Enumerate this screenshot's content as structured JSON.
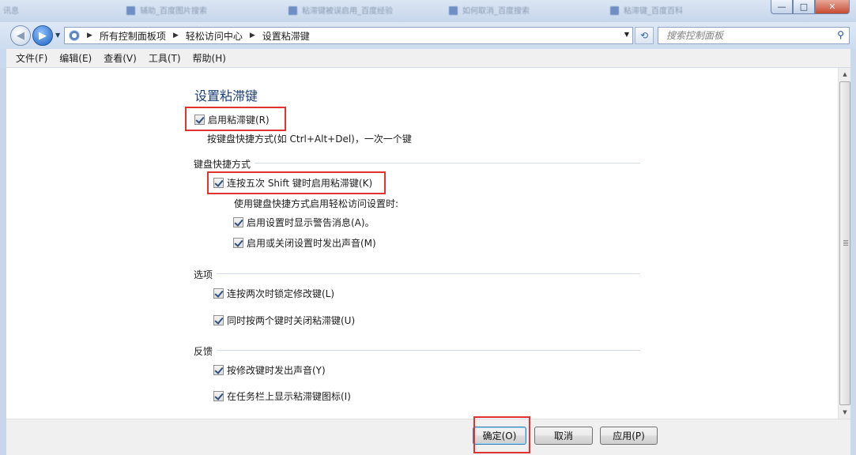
{
  "titlebar": {
    "ghost_tabs": [
      "讯息",
      "辅助_百度图片搜索",
      "粘滞键被误启用_百度经验",
      "如何取消_百度搜索",
      "粘滞键_百度百科"
    ],
    "buttons": {
      "minimize": "—",
      "maximize": "□",
      "close": "✕"
    }
  },
  "nav": {
    "back_icon": "back-arrow-icon",
    "forward_icon": "forward-arrow-icon",
    "breadcrumb": [
      "所有控制面板项",
      "轻松访问中心",
      "设置粘滞键"
    ],
    "search_placeholder": "搜索控制面板"
  },
  "menu": [
    "文件(F)",
    "编辑(E)",
    "查看(V)",
    "工具(T)",
    "帮助(H)"
  ],
  "page": {
    "title": "设置粘滞键",
    "enable": {
      "label": "启用粘滞键(R)",
      "checked": true
    },
    "enable_desc": "按键盘快捷方式(如 Ctrl+Alt+Del)，一次一个键",
    "shortcut_section": "键盘快捷方式",
    "shift5": {
      "label": "连按五次 Shift 键时启用粘滞键(K)",
      "checked": true
    },
    "shortcut_sub": "使用键盘快捷方式启用轻松访问设置时:",
    "warn": {
      "label": "启用设置时显示警告消息(A)。",
      "checked": true
    },
    "sound": {
      "label": "启用或关闭设置时发出声音(M)",
      "checked": true
    },
    "options_section": "选项",
    "lock": {
      "label": "连按两次时锁定修改键(L)",
      "checked": true
    },
    "turnoff": {
      "label": "同时按两个键时关闭粘滞键(U)",
      "checked": true
    },
    "feedback_section": "反馈",
    "beep": {
      "label": "按修改键时发出声音(Y)",
      "checked": true
    },
    "taskbar": {
      "label": "在任务栏上显示粘滞键图标(I)",
      "checked": true
    }
  },
  "footer": {
    "ok": "确定(O)",
    "cancel": "取消",
    "apply": "应用(P)"
  },
  "colors": {
    "highlight": "#e23232",
    "title": "#1e3f7a",
    "window_frame": "#c9d9ee"
  }
}
